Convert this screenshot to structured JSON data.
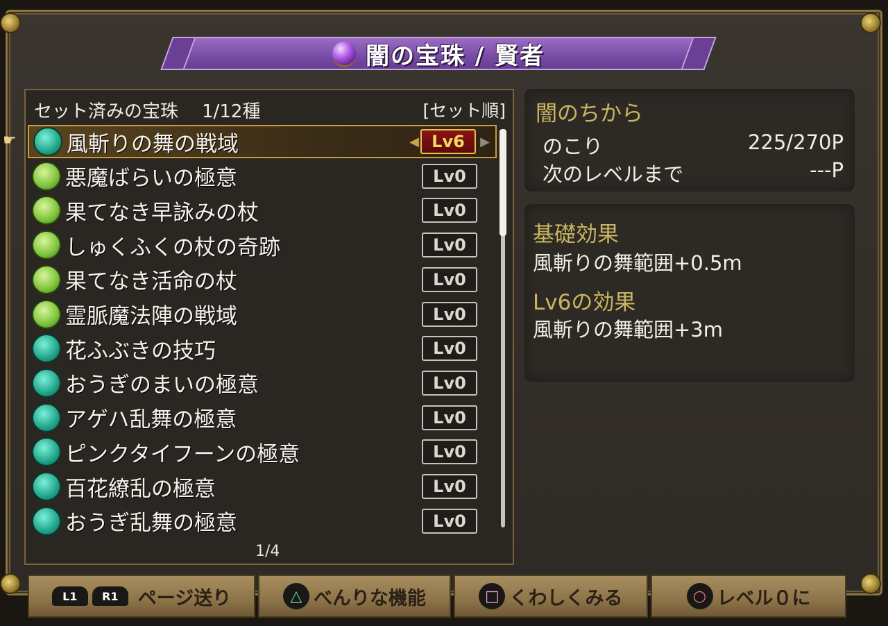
{
  "header": {
    "title": "闇の宝珠 / 賢者"
  },
  "list_panel": {
    "heading": "セット済みの宝珠",
    "count": "1/12種",
    "sort_label": "[セット順]",
    "page": "1/4",
    "items": [
      {
        "name": "風斬りの舞の戦域",
        "level": "Lv6",
        "icon": "dance-icon",
        "selected": true
      },
      {
        "name": "悪魔ばらいの極意",
        "level": "Lv0",
        "icon": "staff-icon"
      },
      {
        "name": "果てなき早詠みの杖",
        "level": "Lv0",
        "icon": "staff-icon"
      },
      {
        "name": "しゅくふくの杖の奇跡",
        "level": "Lv0",
        "icon": "staff-icon"
      },
      {
        "name": "果てなき活命の杖",
        "level": "Lv0",
        "icon": "staff-icon"
      },
      {
        "name": "霊脈魔法陣の戦域",
        "level": "Lv0",
        "icon": "staff-icon"
      },
      {
        "name": "花ふぶきの技巧",
        "level": "Lv0",
        "icon": "dance-icon"
      },
      {
        "name": "おうぎのまいの極意",
        "level": "Lv0",
        "icon": "dance-icon"
      },
      {
        "name": "アゲハ乱舞の極意",
        "level": "Lv0",
        "icon": "dance-icon"
      },
      {
        "name": "ピンクタイフーンの極意",
        "level": "Lv0",
        "icon": "dance-icon"
      },
      {
        "name": "百花繚乱の極意",
        "level": "Lv0",
        "icon": "dance-icon"
      },
      {
        "name": "おうぎ乱舞の極意",
        "level": "Lv0",
        "icon": "dance-icon"
      }
    ]
  },
  "power_box": {
    "heading": "闇のちから",
    "remaining_label": "のこり",
    "remaining_value": "225/270P",
    "next_label": "次のレベルまで",
    "next_value": "---P"
  },
  "effect_box": {
    "base_heading": "基礎効果",
    "base_effect": "風斬りの舞範囲+0.5m",
    "level_heading": "Lv6の効果",
    "level_effect": "風斬りの舞範囲+3m"
  },
  "footer": {
    "l1": "L1",
    "r1": "R1",
    "page_turn": "ページ送り",
    "triangle_symbol": "△",
    "convenient": "べんりな機能",
    "square_symbol": "□",
    "details": "くわしくみる",
    "circle_symbol": "○",
    "reset": "レベル０に"
  },
  "colors": {
    "title_purple": "#7b4ea8",
    "heading_gold": "#c9b660",
    "level_active_red": "#8a1414"
  }
}
